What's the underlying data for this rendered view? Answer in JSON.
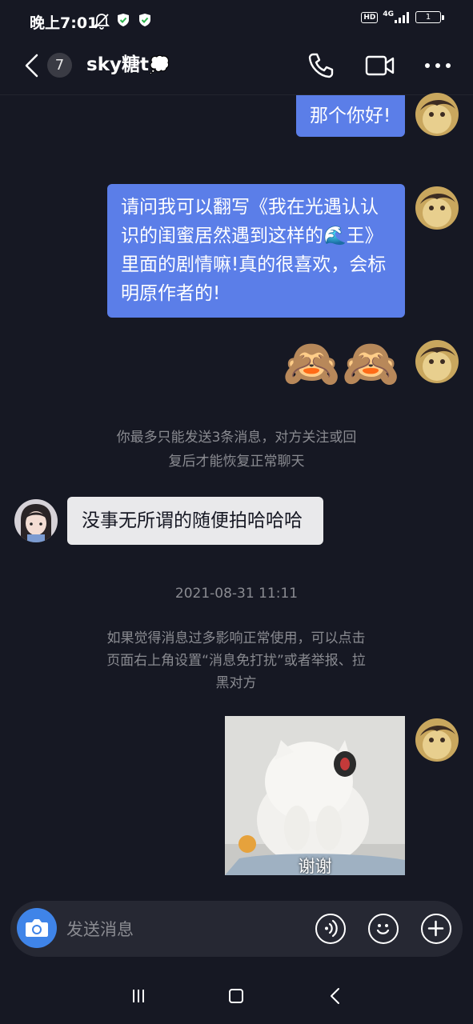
{
  "status_bar": {
    "time": "晚上7:01",
    "network_badge": "HD",
    "network_type": "4G",
    "battery_level": "1"
  },
  "header": {
    "unread_count": "7",
    "title": "sky糖t",
    "title_emoji": "💭"
  },
  "messages": {
    "m1": "那个你好!",
    "m2_lines": [
      "请问我可以翻写《我在光遇认认",
      "识的闺蜜居然遇到这样的🌊王》",
      "里面的剧情嘛!真的很喜欢，会标",
      "明原作者的!"
    ],
    "m3_emoji": "🙈🙈",
    "system_limit_lines": [
      "你最多只能发送3条消息，对方关注或回",
      "复后才能恢复正常聊天"
    ],
    "reply": "没事无所谓的随便拍哈哈哈",
    "timestamp": "2021-08-31 11:11",
    "system_notice_lines": [
      "如果觉得消息过多影响正常使用，可以点击",
      "页面右上角设置“消息免打扰”或者举报、拉",
      "黑对方"
    ],
    "sticker_caption": "谢谢"
  },
  "input": {
    "placeholder": "发送消息"
  },
  "colors": {
    "background": "#161823",
    "my_bubble": "#5b7ee8",
    "their_bubble": "#e9e9eb",
    "camera_button": "#3f84e8"
  }
}
